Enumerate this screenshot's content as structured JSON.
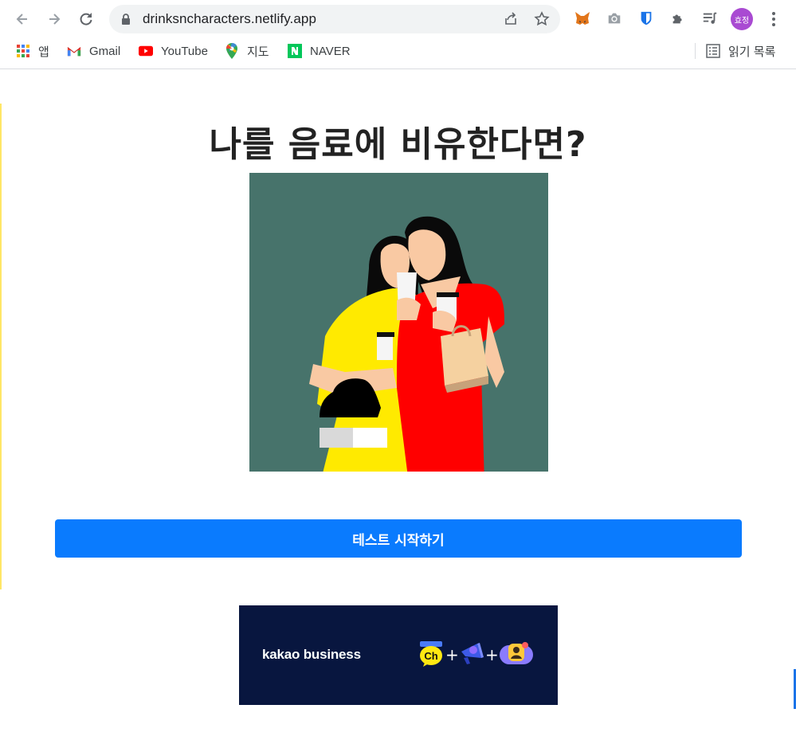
{
  "browser": {
    "url": "drinksncharacters.netlify.app",
    "profile_initials": "효정",
    "bookmarks": [
      {
        "label": "앱",
        "icon": "apps-grid-icon"
      },
      {
        "label": "Gmail",
        "icon": "gmail-icon"
      },
      {
        "label": "YouTube",
        "icon": "youtube-icon"
      },
      {
        "label": "지도",
        "icon": "maps-pin-icon"
      },
      {
        "label": "NAVER",
        "icon": "naver-icon"
      }
    ],
    "reading_list_label": "읽기 목록"
  },
  "page": {
    "title": "나를 음료에 비유한다면?",
    "start_button": "테스트 시작하기",
    "ad": {
      "brand": "kakao business",
      "badge_ch": "Ch"
    }
  },
  "colors": {
    "accent": "#0a7bfe",
    "hero_bg": "#47736b",
    "ad_bg": "#08163f"
  }
}
